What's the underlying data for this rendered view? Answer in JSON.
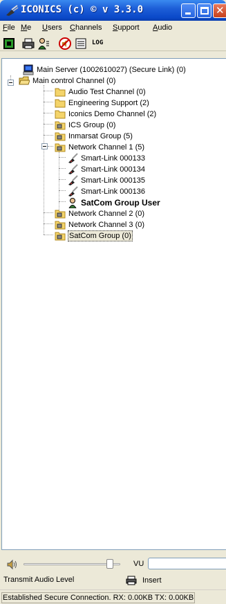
{
  "window": {
    "title": "ICONICS (c) © v 3.3.0"
  },
  "menu": {
    "items": [
      {
        "label": "File",
        "accel": "F",
        "rest": "ile"
      },
      {
        "label": "Me",
        "accel": "M",
        "rest": "e"
      },
      {
        "label": "Users",
        "accel": "U",
        "rest": "sers"
      },
      {
        "label": "Channels",
        "accel": "C",
        "rest": "hannels"
      },
      {
        "label": "Support",
        "accel": "S",
        "rest": "upport"
      },
      {
        "label": "Audio",
        "accel": "A",
        "rest": "udio"
      }
    ]
  },
  "toolbar": {
    "log_label": "LOG"
  },
  "tree": {
    "root": "Main Server (1002610027) (Secure Link) (0)",
    "main_channel": "Main control Channel (0)",
    "channels": [
      "Audio Test Channel (0)",
      "Engineering Support (2)",
      "Iconics Demo Channel (2)",
      "ICS Group (0)",
      "Inmarsat Group (5)",
      "Network Channel 1 (5)"
    ],
    "network1_children": [
      "Smart-Link 000133",
      "Smart-Link 000134",
      "Smart-Link 000135",
      "Smart-Link 000136",
      "SatCom Group User"
    ],
    "after": [
      "Network Channel 2 (0)",
      "Network Channel 3 (0)",
      "SatCom Group (0)"
    ]
  },
  "audio": {
    "vu_label": "VU",
    "transmit_label": "Transmit Audio Level",
    "insert_label": "Insert",
    "transmit_level": 0.92
  },
  "status": {
    "text": "Established Secure Connection. RX: 0.00KB TX: 0.00KB"
  },
  "colors": {
    "title_bar": "#1e5fd8",
    "selection": "#ece9d8",
    "folder": "#f4d46a"
  }
}
